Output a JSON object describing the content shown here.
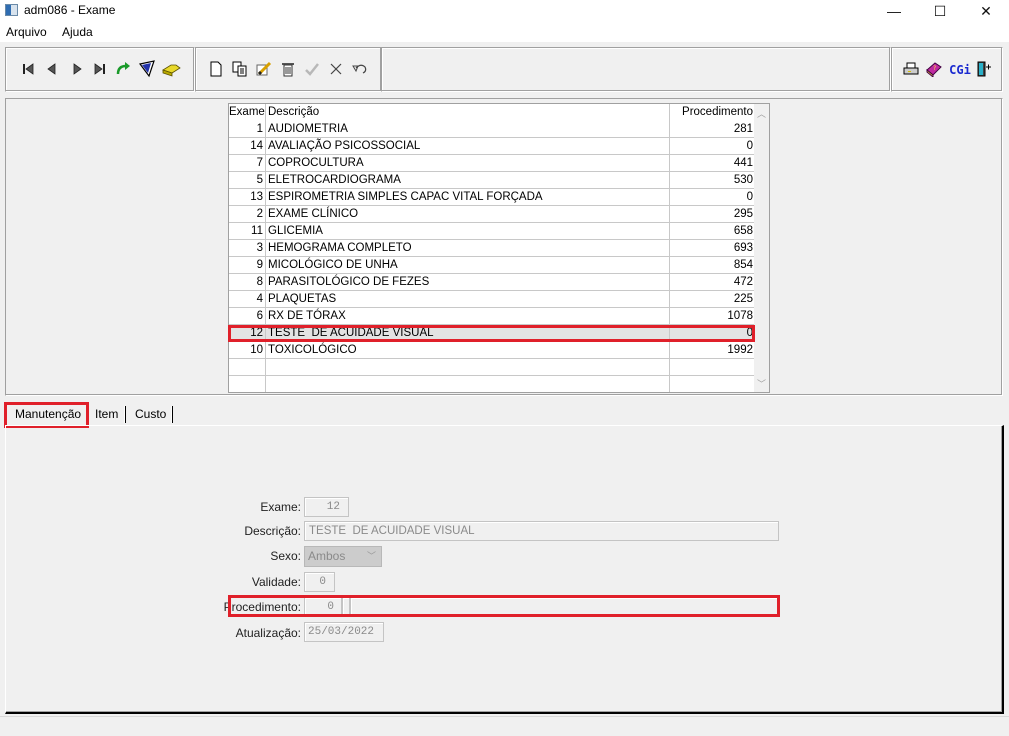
{
  "window": {
    "title": "adm086 - Exame",
    "icon": "app-window-icon",
    "controls": {
      "minimize": "—",
      "maximize": "☐",
      "close": "✕"
    }
  },
  "menu": [
    {
      "label": "Arquivo"
    },
    {
      "label": "Ajuda"
    }
  ],
  "toolbar": {
    "navigation": [
      {
        "name": "first-record-icon",
        "glyph": "⏮"
      },
      {
        "name": "previous-record-icon",
        "glyph": "◀"
      },
      {
        "name": "next-record-icon",
        "glyph": "▶"
      },
      {
        "name": "last-record-icon",
        "glyph": "⏭"
      },
      {
        "name": "refresh-icon",
        "glyph": "↷"
      },
      {
        "name": "filter-icon",
        "glyph": "⛛"
      },
      {
        "name": "search-folder-icon",
        "glyph": "➦"
      }
    ],
    "editing": [
      {
        "name": "new-document-icon",
        "glyph": "🗋"
      },
      {
        "name": "copy-icon",
        "glyph": "⎘"
      },
      {
        "name": "edit-pencil-icon",
        "glyph": "✎"
      },
      {
        "name": "delete-trash-icon",
        "glyph": "🗑"
      },
      {
        "name": "confirm-check-icon",
        "glyph": "✔"
      },
      {
        "name": "cancel-x-icon",
        "glyph": "✕"
      },
      {
        "name": "undo-icon",
        "glyph": "↶"
      }
    ],
    "extras": [
      {
        "name": "print-icon",
        "glyph": "⎙"
      },
      {
        "name": "help-book-icon",
        "glyph": "📕"
      },
      {
        "name": "cgi-icon",
        "glyph": "CGi"
      },
      {
        "name": "exit-door-icon",
        "glyph": "⍈"
      }
    ]
  },
  "grid": {
    "headers": {
      "exame": "Exame",
      "descricao": "Descrição",
      "procedimento": "Procedimento"
    },
    "rows": [
      {
        "exame": "1",
        "descricao": "AUDIOMETRIA",
        "procedimento": "281"
      },
      {
        "exame": "14",
        "descricao": "AVALIAÇÃO PSICOSSOCIAL",
        "procedimento": "0"
      },
      {
        "exame": "7",
        "descricao": "COPROCULTURA",
        "procedimento": "441"
      },
      {
        "exame": "5",
        "descricao": "ELETROCARDIOGRAMA",
        "procedimento": "530"
      },
      {
        "exame": "13",
        "descricao": "ESPIROMETRIA SIMPLES CAPAC VITAL FORÇADA",
        "procedimento": "0"
      },
      {
        "exame": "2",
        "descricao": "EXAME CLÍNICO",
        "procedimento": "295"
      },
      {
        "exame": "11",
        "descricao": "GLICEMIA",
        "procedimento": "658"
      },
      {
        "exame": "3",
        "descricao": "HEMOGRAMA COMPLETO",
        "procedimento": "693"
      },
      {
        "exame": "9",
        "descricao": "MICOLÓGICO DE UNHA",
        "procedimento": "854"
      },
      {
        "exame": "8",
        "descricao": "PARASITOLÓGICO DE FEZES",
        "procedimento": "472"
      },
      {
        "exame": "4",
        "descricao": "PLAQUETAS",
        "procedimento": "225"
      },
      {
        "exame": "6",
        "descricao": "RX DE TÓRAX",
        "procedimento": "1078"
      },
      {
        "exame": "12",
        "descricao": "TESTE  DE ACUIDADE VISUAL",
        "procedimento": "0",
        "selected": true
      },
      {
        "exame": "10",
        "descricao": "TOXICOLÓGICO",
        "procedimento": "1992"
      },
      {
        "exame": "",
        "descricao": "",
        "procedimento": ""
      },
      {
        "exame": "",
        "descricao": "",
        "procedimento": ""
      }
    ]
  },
  "tabs": [
    {
      "label": "Manutenção",
      "active": true
    },
    {
      "label": "Item"
    },
    {
      "label": "Custo"
    }
  ],
  "form": {
    "exame": {
      "label": "Exame:",
      "value": "12"
    },
    "descricao": {
      "label": "Descrição:",
      "value": "TESTE  DE ACUIDADE VISUAL"
    },
    "sexo": {
      "label": "Sexo:",
      "value": "Ambos"
    },
    "validade": {
      "label": "Validade:",
      "value": "0"
    },
    "procedimento": {
      "label": "Procedimento:",
      "value": "0",
      "description": ""
    },
    "atualizacao": {
      "label": "Atualização:",
      "value": "25/03/2022"
    }
  },
  "colors": {
    "highlight": "#e0202a",
    "selected_row": "#e3e3e3"
  }
}
